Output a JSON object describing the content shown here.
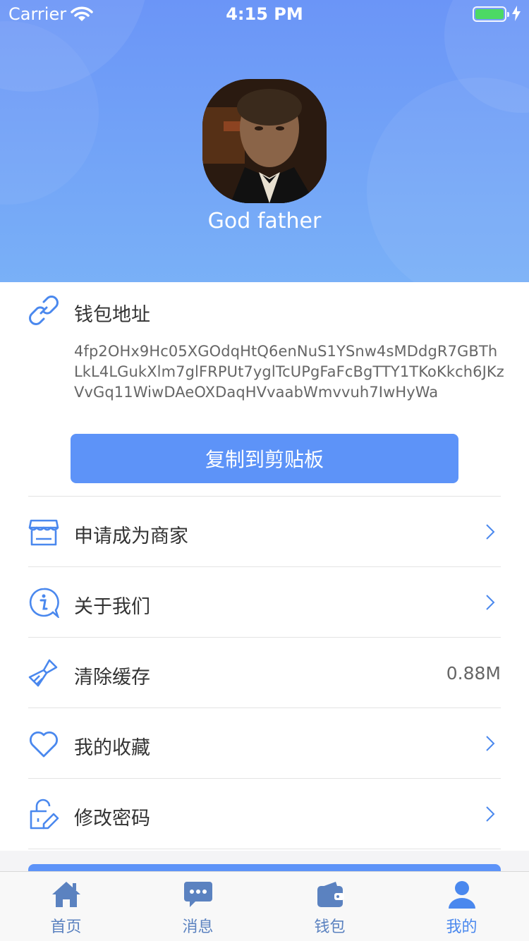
{
  "status_bar": {
    "carrier": "Carrier",
    "time": "4:15 PM"
  },
  "profile": {
    "username": "God father"
  },
  "wallet": {
    "title": "钱包地址",
    "address": "4fp2OHx9Hc05XGOdqHtQ6enNuS1YSnw4sMDdgR7GBThLkL4LGukXlm7glFRPUt7yglTcUPgFaFcBgTTY1TKoKkch6JKzVvGq11WiwDAeOXDaqHVvaabWmvvuh7IwHyWa",
    "copy_label": "复制到剪贴板"
  },
  "menu": [
    {
      "icon": "store-icon",
      "label": "申请成为商家"
    },
    {
      "icon": "info-icon",
      "label": "关于我们"
    },
    {
      "icon": "brush-icon",
      "label": "清除缓存",
      "value": "0.88M"
    },
    {
      "icon": "heart-icon",
      "label": "我的收藏"
    },
    {
      "icon": "lock-edit-icon",
      "label": "修改密码"
    }
  ],
  "tabs": [
    {
      "icon": "home-icon",
      "label": "首页"
    },
    {
      "icon": "message-icon",
      "label": "消息"
    },
    {
      "icon": "wallet-icon",
      "label": "钱包"
    },
    {
      "icon": "user-icon",
      "label": "我的"
    }
  ],
  "colors": {
    "accent": "#5d93f8",
    "header_top": "#6b95f7",
    "header_bottom": "#79b0f7",
    "tab_active": "#4a88ee"
  }
}
